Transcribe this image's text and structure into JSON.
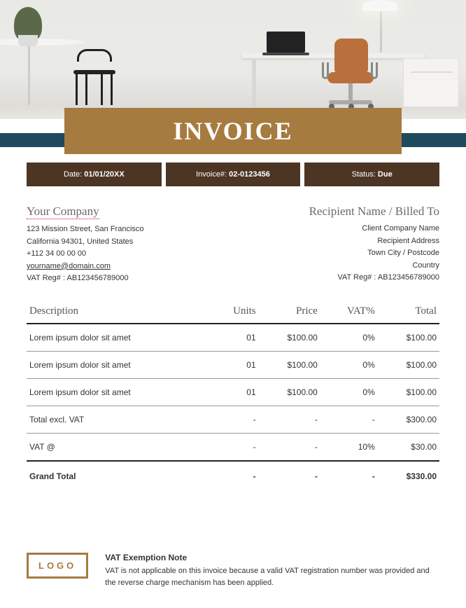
{
  "banner": {
    "title": "INVOICE"
  },
  "meta": {
    "date_label": "Date:",
    "date_value": "01/01/20XX",
    "invoice_label": "Invoice#:",
    "invoice_value": "02-0123456",
    "status_label": "Status:",
    "status_value": "Due"
  },
  "sender": {
    "heading": "Your Company",
    "line1": "123 Mission Street, San Francisco",
    "line2": "California 94301, United States",
    "phone": "+112 34 00 00 00",
    "email": "yourname@domain.com",
    "vat": "VAT Reg# :  AB123456789000"
  },
  "recipient": {
    "heading": "Recipient Name / Billed To",
    "line1": "Client Company Name",
    "line2": "Recipient Address",
    "line3": "Town City / Postcode",
    "line4": "Country",
    "vat": "VAT Reg# :  AB123456789000"
  },
  "table": {
    "headers": {
      "description": "Description",
      "units": "Units",
      "price": "Price",
      "vat": "VAT%",
      "total": "Total"
    },
    "rows": [
      {
        "desc": "Lorem ipsum dolor sit amet",
        "units": "01",
        "price": "$100.00",
        "vat": "0%",
        "total": "$100.00"
      },
      {
        "desc": "Lorem ipsum dolor sit amet",
        "units": "01",
        "price": "$100.00",
        "vat": "0%",
        "total": "$100.00"
      },
      {
        "desc": "Lorem ipsum dolor sit amet",
        "units": "01",
        "price": "$100.00",
        "vat": "0%",
        "total": "$100.00"
      }
    ],
    "subtotal": {
      "label": "Total excl. VAT",
      "units": "-",
      "price": "-",
      "vat": "-",
      "total": "$300.00"
    },
    "vat_row": {
      "label": "VAT @",
      "units": "-",
      "price": "-",
      "vat": "10%",
      "total": "$30.00"
    },
    "grand": {
      "label": "Grand Total",
      "units": "-",
      "price": "-",
      "vat": "-",
      "total": "$330.00"
    }
  },
  "footer": {
    "logo": "LOGO",
    "note_title": "VAT Exemption Note",
    "note_body": "VAT is not applicable on this invoice because a valid VAT registration number was provided and the reverse charge mechanism has been applied."
  }
}
